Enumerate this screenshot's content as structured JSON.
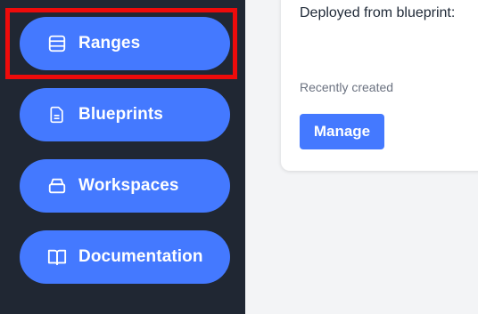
{
  "sidebar": {
    "items": [
      {
        "label": "Ranges",
        "icon": "stack-icon"
      },
      {
        "label": "Blueprints",
        "icon": "document-icon"
      },
      {
        "label": "Workspaces",
        "icon": "archive-box-icon"
      },
      {
        "label": "Documentation",
        "icon": "book-icon"
      }
    ],
    "highlighted_item": "Ranges"
  },
  "card": {
    "description": "Deployed from blueprint:",
    "meta": "Recently created",
    "manage_label": "Manage"
  },
  "colors": {
    "sidebar_bg": "#202733",
    "accent": "#4479ff",
    "highlight": "#ee0b0b",
    "page_bg": "#f3f4f6"
  }
}
